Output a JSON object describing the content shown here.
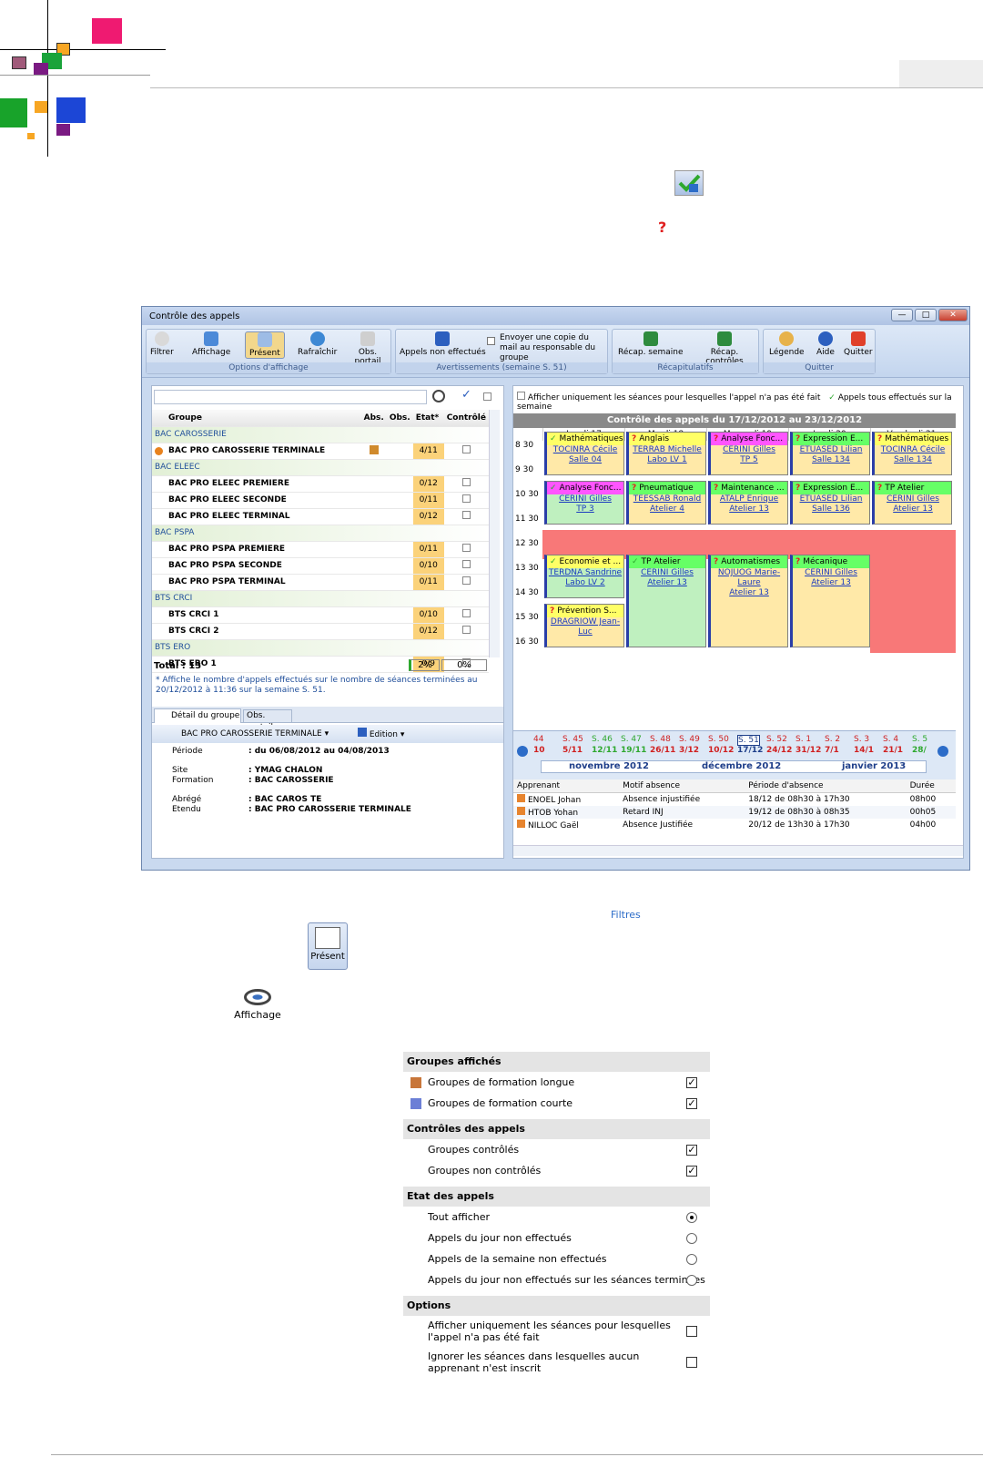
{
  "window": {
    "title": "Contrôle des appels",
    "buttons": {
      "min": "—",
      "max": "□",
      "close": "✕"
    }
  },
  "ribbon": {
    "groups": [
      {
        "caption": "Options d'affichage"
      },
      {
        "caption": "Avertissements (semaine S. 51)"
      },
      {
        "caption": "Récapitulatifs"
      },
      {
        "caption": "Quitter"
      }
    ],
    "filter": "Filtrer",
    "affichage": "Affichage",
    "present": "Présent",
    "rafraichir": "Rafraîchir",
    "obs_portail": "Obs. portail",
    "appels_non_effectues": "Appels non effectués",
    "envoyer_copie": "Envoyer une copie du mail au responsable du groupe",
    "recap_semaine": "Récap. semaine",
    "recap_controles": "Récap. contrôles",
    "legende": "Légende",
    "aide": "Aide",
    "quitter": "Quitter"
  },
  "grid": {
    "headers": [
      "Groupe",
      "Abs.",
      "Obs.",
      "Etat*",
      "Contrôlé"
    ],
    "rows": [
      {
        "type": "cat",
        "name": "BAC CAROSSERIE"
      },
      {
        "type": "grp",
        "name": "BAC PRO CAROSSERIE TERMINALE",
        "etat": "4/11",
        "current": true,
        "abs": true
      },
      {
        "type": "cat",
        "name": "BAC ELEEC"
      },
      {
        "type": "grp",
        "name": "BAC PRO ELEEC PREMIERE",
        "etat": "0/12"
      },
      {
        "type": "grp",
        "name": "BAC PRO ELEEC SECONDE",
        "etat": "0/11"
      },
      {
        "type": "grp",
        "name": "BAC PRO ELEEC TERMINAL",
        "etat": "0/12"
      },
      {
        "type": "cat",
        "name": "BAC PSPA"
      },
      {
        "type": "grp",
        "name": "BAC PRO PSPA PREMIERE",
        "etat": "0/11"
      },
      {
        "type": "grp",
        "name": "BAC PRO PSPA SECONDE",
        "etat": "0/10"
      },
      {
        "type": "grp",
        "name": "BAC PRO PSPA TERMINAL",
        "etat": "0/11"
      },
      {
        "type": "cat",
        "name": "BTS CRCI"
      },
      {
        "type": "grp",
        "name": "BTS CRCI 1",
        "etat": "0/10"
      },
      {
        "type": "grp",
        "name": "BTS CRCI 2",
        "etat": "0/12"
      },
      {
        "type": "cat",
        "name": "BTS ERO"
      },
      {
        "type": "grp",
        "name": "BTS ERO 1",
        "etat": "0/9"
      }
    ],
    "total_label": "Total : 13",
    "total_pct1": "2%",
    "total_pct2": "0%",
    "note": "* Affiche le nombre d'appels effectués sur le nombre de séances terminées au 20/12/2012 à 11:36 sur la semaine S. 51."
  },
  "detail": {
    "tab1": "Détail du groupe",
    "tab2": "Obs. portail",
    "group_select": "BAC PRO CAROSSERIE TERMINALE",
    "edition": "Edition",
    "periode_label": "Période",
    "periode_value": ": du 06/08/2012 au 04/08/2013",
    "site_label": "Site",
    "site_value": ": YMAG CHALON",
    "formation_label": "Formation",
    "formation_value": ": BAC CAROSSERIE",
    "abrege_label": "Abrégé",
    "abrege_value": ": BAC CAROS TE",
    "etendu_label": "Etendu",
    "etendu_value": ": BAC PRO CAROSSERIE TERMINALE"
  },
  "calendar": {
    "option1": "Afficher uniquement les séances pour lesquelles l'appel n'a pas été fait",
    "option2": "Appels tous effectués sur la semaine",
    "title": "Contrôle des appels du 17/12/2012 au 23/12/2012",
    "days": [
      "Lundi 17",
      "Mardi 18",
      "Mercredi 19",
      "Jeudi 20",
      "Vendredi 21"
    ],
    "times": [
      "8 30",
      "9 30",
      "10 30",
      "11 30",
      "12 30",
      "13 30",
      "14 30",
      "15 30",
      "16 30"
    ],
    "weeks": [
      "44",
      "S. 45",
      "S. 46",
      "S. 47",
      "S. 48",
      "S. 49",
      "S. 50",
      "S. 51",
      "S. 52",
      "S. 1",
      "S. 2",
      "S. 3",
      "S. 4",
      "S. 5"
    ],
    "dates": [
      "10",
      "5/11",
      "12/11",
      "19/11",
      "26/11",
      "3/12",
      "10/12",
      "17/12",
      "24/12",
      "31/12",
      "7/1",
      "14/1",
      "21/1",
      "28/"
    ],
    "months": [
      "novembre 2012",
      "décembre 2012",
      "janvier 2013"
    ],
    "slots": [
      {
        "day": 0,
        "row": 0,
        "title": "Mathématiques",
        "l1": "TOCINRA Cécile",
        "l2": "Salle 04",
        "color": "#ffff66",
        "bg": "#ffe9a8",
        "mark": "✓"
      },
      {
        "day": 1,
        "row": 0,
        "title": "Anglais",
        "l1": "TERRAB Michelle",
        "l2": "Labo LV 1",
        "color": "#ffff66",
        "bg": "#ffe9a8",
        "mark": "?"
      },
      {
        "day": 2,
        "row": 0,
        "title": "Analyse Fonc...",
        "l1": "CERINI Gilles",
        "l2": "TP 5",
        "color": "#ff55ff",
        "bg": "#ffe9a8",
        "mark": "?"
      },
      {
        "day": 3,
        "row": 0,
        "title": "Expression E...",
        "l1": "ETUASED Lilian",
        "l2": "Salle 134",
        "color": "#66ff66",
        "bg": "#ffe9a8",
        "mark": "?"
      },
      {
        "day": 4,
        "row": 0,
        "title": "Mathématiques",
        "l1": "TOCINRA Cécile",
        "l2": "Salle 134",
        "color": "#ffff66",
        "bg": "#ffe9a8",
        "mark": "?"
      },
      {
        "day": 0,
        "row": 2,
        "title": "Analyse Fonc...",
        "l1": "CERINI Gilles",
        "l2": "TP 3",
        "color": "#ff55ff",
        "bg": "#bff0bf",
        "mark": "✓"
      },
      {
        "day": 1,
        "row": 2,
        "title": "Pneumatique",
        "l1": "TEESSAB Ronald",
        "l2": "Atelier 4",
        "color": "#66ff66",
        "bg": "#ffe9a8",
        "mark": "?"
      },
      {
        "day": 2,
        "row": 2,
        "title": "Maintenance ...",
        "l1": "ATALP Enrique",
        "l2": "Atelier 13",
        "color": "#66ff66",
        "bg": "#ffe9a8",
        "mark": "?"
      },
      {
        "day": 3,
        "row": 2,
        "title": "Expression E...",
        "l1": "ETUASED Lilian",
        "l2": "Salle 136",
        "color": "#66ff66",
        "bg": "#ffe9a8",
        "mark": "?"
      },
      {
        "day": 4,
        "row": 2,
        "title": "TP Atelier",
        "l1": "CERINI Gilles",
        "l2": "Atelier 13",
        "color": "#66ff66",
        "bg": "#ffe9a8",
        "mark": "?"
      },
      {
        "day": 0,
        "row": 5,
        "title": "Economie et ...",
        "l1": "TERDNA Sandrine",
        "l2": "Labo LV 2",
        "color": "#ffff66",
        "bg": "#bff0bf",
        "mark": "✓"
      },
      {
        "day": 1,
        "row": 5,
        "title": "TP Atelier",
        "l1": "CERINI Gilles",
        "l2": "Atelier 13",
        "color": "#66ff66",
        "bg": "#bff0bf",
        "mark": "✓"
      },
      {
        "day": 2,
        "row": 5,
        "title": "Automatismes",
        "l1": "NOJUOG Marie-Laure",
        "l2": "Atelier 13",
        "color": "#66ff66",
        "bg": "#ffe9a8",
        "mark": "?"
      },
      {
        "day": 3,
        "row": 5,
        "title": "Mécanique",
        "l1": "CERINI Gilles",
        "l2": "Atelier 13",
        "color": "#66ff66",
        "bg": "#ffe9a8",
        "mark": "?"
      },
      {
        "day": 0,
        "row": 7,
        "title": "Prévention S...",
        "l1": "DRAGRIOW Jean-Luc",
        "l2": "",
        "color": "#ffff66",
        "bg": "#ffe9a8",
        "mark": "?"
      }
    ]
  },
  "absences": {
    "headers": [
      "Apprenant",
      "Motif absence",
      "Période d'absence",
      "Durée"
    ],
    "rows": [
      [
        "ENOEL Johan",
        "Absence injustifiée",
        "18/12 de 08h30 à 17h30",
        "08h00"
      ],
      [
        "HTOB Yohan",
        "Retard INJ",
        "19/12 de 08h30 à 08h35",
        "00h05"
      ],
      [
        "NILLOC Gaël",
        "Absence Justifiée",
        "20/12 de 13h30 à 17h30",
        "04h00"
      ]
    ]
  },
  "below": {
    "filtres": "Filtres",
    "present_label": "Présent",
    "affichage_label": "Affichage"
  },
  "dropdown": {
    "sec1": "Groupes affichés",
    "g_longue": "Groupes de formation longue",
    "g_courte": "Groupes de formation courte",
    "sec2": "Contrôles des appels",
    "controles": "Groupes contrôlés",
    "non_controles": "Groupes non contrôlés",
    "sec3": "Etat des appels",
    "tout": "Tout afficher",
    "jour": "Appels du jour non effectués",
    "semaine": "Appels de la semaine non effectués",
    "seances": "Appels du jour non effectués sur les séances terminées",
    "sec4": "Options",
    "opt1": "Afficher uniquement les séances pour lesquelles l'appel n'a pas été fait",
    "opt2": "Ignorer les séances dans lesquelles aucun apprenant n'est inscrit"
  }
}
